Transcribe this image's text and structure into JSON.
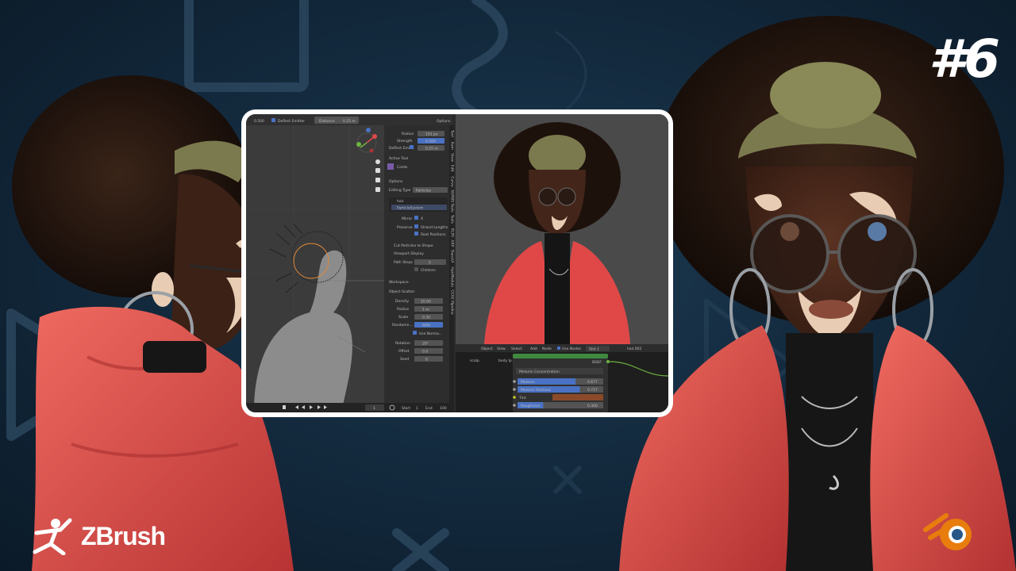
{
  "episode_number": "#6",
  "zbrush_logo": {
    "text": "ZBrush"
  },
  "blender_logo": {
    "label": "blender-logo"
  },
  "blender_ui": {
    "top_bar": {
      "value": "0.500",
      "deflect": "Deflect Emitter",
      "distance_label": "Distance",
      "distance_value": "0.25 m",
      "options": "Options"
    },
    "props": {
      "radius_label": "Radius",
      "radius_value": "101 px",
      "strength_label": "Strength",
      "strength_value": "0.500",
      "deflect_label": "Deflect Emit...",
      "deflect_value": "0.25 m",
      "active_tool": "Active Tool",
      "comb": "Comb",
      "options": "Options",
      "editing_type_label": "Editing Type",
      "editing_type_value": "Particles",
      "hair": "hair",
      "particle_system": "ParticleSystem",
      "mirror_label": "Mirror",
      "mirror_value": "X",
      "preserve_label": "Preserve",
      "strand_lengths": "Strand Lengths",
      "root_positions": "Root Positions",
      "cut_particles": "Cut Particles to Shape",
      "viewport_display": "Viewport Display",
      "path_steps_label": "Path Steps",
      "path_steps_value": "5",
      "children": "Children",
      "workspace": "Workspace",
      "object_scatter": "Object Scatter",
      "density_label": "Density",
      "density_value": "10.00",
      "radius2_label": "Radius",
      "radius2_value": "1 m",
      "scale_label": "Scale",
      "scale_value": "0.30",
      "randomness_label": "Randomn...",
      "randomness_value": "60%",
      "use_normal": "Use Norma...",
      "rotation_label": "Rotation",
      "rotation_value": "29°",
      "offset_label": "Offset",
      "offset_value": "0.0",
      "seed_label": "Seed",
      "seed_value": "0"
    },
    "side_tabs": [
      "Tool",
      "Item",
      "View",
      "Edit",
      "Curve",
      "NURBS Tools",
      "Tools",
      "RLPS",
      "ARP",
      "TransUI",
      "HairModule",
      "CCAE Pipeline"
    ],
    "timeline": {
      "current": "1",
      "start_label": "Start",
      "start_value": "1",
      "end_label": "End",
      "end_value": "100"
    },
    "node_header": {
      "mode": "Object",
      "menus": [
        "View",
        "Select",
        "Add",
        "Node"
      ],
      "use_nodes": "Use Nodes",
      "slot": "Slot 1",
      "material": "hair.002"
    },
    "breadcrumb": [
      "scalp",
      "body lp.003",
      "hair.002"
    ],
    "node": {
      "bsdf": "BSDF",
      "dropdown": "Melanin Concentration",
      "melanin_label": "Melanin",
      "melanin_value": "0.677",
      "melanin_fill": 0.677,
      "melanin_redness_label": "Melanin Redness",
      "melanin_redness_value": "0.727",
      "melanin_redness_fill": 0.727,
      "tint_label": "Tint",
      "roughness_label": "Roughness",
      "roughness_value": "0.300",
      "roughness_fill": 0.3
    }
  },
  "colors": {
    "accent_blue": "#4a72c4",
    "jacket_red": "#e04848",
    "headwrap_green": "#7b7a4e",
    "background": "#12283b"
  }
}
